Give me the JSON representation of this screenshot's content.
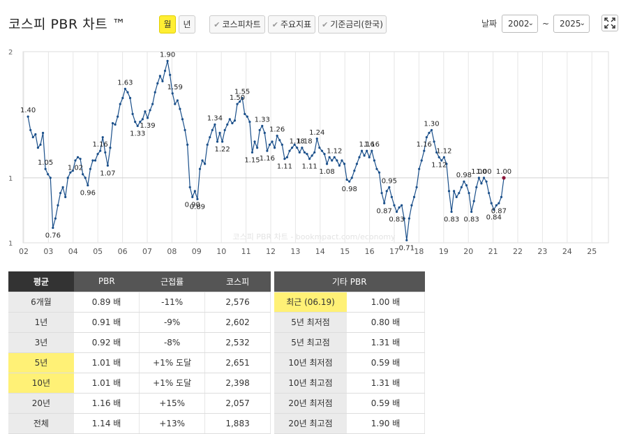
{
  "header": {
    "title": "코스피 PBR 차트 ™",
    "period_month": "월",
    "period_year": "년",
    "toggle_kospi": "코스피차트",
    "toggle_indicators": "주요지표",
    "toggle_rate": "기준금리(한국)",
    "date_label": "날짜",
    "start_year": "2002",
    "end_year": "2025",
    "tilde": "~"
  },
  "chart_data": {
    "type": "line",
    "y_scale": "log",
    "ylim": [
      1,
      2
    ],
    "y_ticks": [
      "1",
      "1",
      "2"
    ],
    "x_ticks": [
      "02",
      "03",
      "04",
      "05",
      "06",
      "07",
      "08",
      "09",
      "10",
      "11",
      "12",
      "13",
      "14",
      "15",
      "16",
      "17",
      "18",
      "19",
      "20",
      "21",
      "22",
      "23",
      "24",
      "25"
    ],
    "watermark": "코스피 PBR 차트 - bookmpact.com/economy",
    "colors": {
      "line": "#1a4f8a",
      "last_point": "#8b1538"
    },
    "x_start": 2002.0,
    "x_end": 2025.5,
    "series": [
      {
        "points": [
          [
            2002.2,
            1.4
          ],
          [
            2002.3,
            1.3
          ],
          [
            2002.4,
            1.25
          ],
          [
            2002.5,
            1.27
          ],
          [
            2002.6,
            1.18
          ],
          [
            2002.7,
            1.2
          ],
          [
            2002.8,
            1.28
          ],
          [
            2002.9,
            1.05
          ],
          [
            2003.0,
            1.02
          ],
          [
            2003.1,
            1.0
          ],
          [
            2003.2,
            0.76
          ],
          [
            2003.3,
            0.8
          ],
          [
            2003.4,
            0.86
          ],
          [
            2003.5,
            0.92
          ],
          [
            2003.6,
            0.95
          ],
          [
            2003.7,
            0.9
          ],
          [
            2003.8,
            1.0
          ],
          [
            2003.9,
            1.03
          ],
          [
            2004.0,
            1.04
          ],
          [
            2004.1,
            1.1
          ],
          [
            2004.2,
            1.12
          ],
          [
            2004.3,
            1.11
          ],
          [
            2004.4,
            1.02
          ],
          [
            2004.5,
            1.0
          ],
          [
            2004.6,
            0.96
          ],
          [
            2004.7,
            1.05
          ],
          [
            2004.8,
            1.1
          ],
          [
            2004.9,
            1.1
          ],
          [
            2005.0,
            1.14
          ],
          [
            2005.1,
            1.16
          ],
          [
            2005.2,
            1.25
          ],
          [
            2005.3,
            1.15
          ],
          [
            2005.4,
            1.07
          ],
          [
            2005.5,
            1.18
          ],
          [
            2005.6,
            1.35
          ],
          [
            2005.7,
            1.34
          ],
          [
            2005.8,
            1.4
          ],
          [
            2005.9,
            1.5
          ],
          [
            2006.0,
            1.55
          ],
          [
            2006.1,
            1.63
          ],
          [
            2006.2,
            1.6
          ],
          [
            2006.3,
            1.55
          ],
          [
            2006.4,
            1.42
          ],
          [
            2006.5,
            1.36
          ],
          [
            2006.6,
            1.33
          ],
          [
            2006.7,
            1.36
          ],
          [
            2006.8,
            1.38
          ],
          [
            2006.9,
            1.44
          ],
          [
            2007.0,
            1.39
          ],
          [
            2007.1,
            1.45
          ],
          [
            2007.2,
            1.5
          ],
          [
            2007.3,
            1.6
          ],
          [
            2007.4,
            1.68
          ],
          [
            2007.5,
            1.75
          ],
          [
            2007.6,
            1.7
          ],
          [
            2007.7,
            1.8
          ],
          [
            2007.8,
            1.9
          ],
          [
            2007.9,
            1.76
          ],
          [
            2008.0,
            1.59
          ],
          [
            2008.1,
            1.5
          ],
          [
            2008.2,
            1.53
          ],
          [
            2008.3,
            1.46
          ],
          [
            2008.4,
            1.38
          ],
          [
            2008.5,
            1.3
          ],
          [
            2008.6,
            1.2
          ],
          [
            2008.7,
            0.95
          ],
          [
            2008.8,
            0.9
          ],
          [
            2008.9,
            0.93
          ],
          [
            2009.0,
            0.89
          ],
          [
            2009.1,
            1.05
          ],
          [
            2009.2,
            1.1
          ],
          [
            2009.3,
            1.08
          ],
          [
            2009.4,
            1.2
          ],
          [
            2009.5,
            1.25
          ],
          [
            2009.6,
            1.3
          ],
          [
            2009.7,
            1.34
          ],
          [
            2009.8,
            1.22
          ],
          [
            2009.9,
            1.28
          ],
          [
            2010.0,
            1.22
          ],
          [
            2010.1,
            1.3
          ],
          [
            2010.2,
            1.34
          ],
          [
            2010.3,
            1.38
          ],
          [
            2010.4,
            1.35
          ],
          [
            2010.5,
            1.37
          ],
          [
            2010.6,
            1.5
          ],
          [
            2010.7,
            1.52
          ],
          [
            2010.8,
            1.55
          ],
          [
            2010.9,
            1.42
          ],
          [
            2011.0,
            1.4
          ],
          [
            2011.1,
            1.36
          ],
          [
            2011.2,
            1.15
          ],
          [
            2011.3,
            1.22
          ],
          [
            2011.4,
            1.18
          ],
          [
            2011.5,
            1.3
          ],
          [
            2011.6,
            1.33
          ],
          [
            2011.7,
            1.28
          ],
          [
            2011.8,
            1.16
          ],
          [
            2011.9,
            1.2
          ],
          [
            2012.0,
            1.22
          ],
          [
            2012.1,
            1.18
          ],
          [
            2012.2,
            1.26
          ],
          [
            2012.3,
            1.23
          ],
          [
            2012.4,
            1.2
          ],
          [
            2012.5,
            1.11
          ],
          [
            2012.6,
            1.12
          ],
          [
            2012.7,
            1.16
          ],
          [
            2012.8,
            1.18
          ],
          [
            2012.9,
            1.2
          ],
          [
            2013.0,
            1.18
          ],
          [
            2013.1,
            1.15
          ],
          [
            2013.2,
            1.18
          ],
          [
            2013.3,
            1.15
          ],
          [
            2013.4,
            1.14
          ],
          [
            2013.5,
            1.11
          ],
          [
            2013.6,
            1.13
          ],
          [
            2013.7,
            1.15
          ],
          [
            2013.8,
            1.24
          ],
          [
            2013.9,
            1.18
          ],
          [
            2014.0,
            1.16
          ],
          [
            2014.1,
            1.14
          ],
          [
            2014.2,
            1.08
          ],
          [
            2014.3,
            1.12
          ],
          [
            2014.4,
            1.1
          ],
          [
            2014.5,
            1.12
          ],
          [
            2014.6,
            1.1
          ],
          [
            2014.7,
            1.07
          ],
          [
            2014.8,
            1.1
          ],
          [
            2014.9,
            1.08
          ],
          [
            2015.0,
            0.99
          ],
          [
            2015.1,
            0.98
          ],
          [
            2015.2,
            1.0
          ],
          [
            2015.3,
            1.04
          ],
          [
            2015.4,
            1.08
          ],
          [
            2015.5,
            1.12
          ],
          [
            2015.6,
            1.16
          ],
          [
            2015.7,
            1.13
          ],
          [
            2015.8,
            1.16
          ],
          [
            2015.9,
            1.12
          ],
          [
            2016.0,
            1.16
          ],
          [
            2016.1,
            1.1
          ],
          [
            2016.2,
            1.05
          ],
          [
            2016.3,
            1.03
          ],
          [
            2016.4,
            0.92
          ],
          [
            2016.5,
            0.87
          ],
          [
            2016.6,
            0.93
          ],
          [
            2016.7,
            0.95
          ],
          [
            2016.8,
            0.9
          ],
          [
            2016.9,
            0.86
          ],
          [
            2017.0,
            0.83
          ],
          [
            2017.1,
            0.85
          ],
          [
            2017.2,
            0.86
          ],
          [
            2017.3,
            0.8
          ],
          [
            2017.4,
            0.71
          ],
          [
            2017.5,
            0.8
          ],
          [
            2017.6,
            0.86
          ],
          [
            2017.7,
            0.9
          ],
          [
            2017.8,
            0.95
          ],
          [
            2017.9,
            1.05
          ],
          [
            2018.0,
            1.1
          ],
          [
            2018.1,
            1.16
          ],
          [
            2018.2,
            1.25
          ],
          [
            2018.3,
            1.28
          ],
          [
            2018.4,
            1.3
          ],
          [
            2018.5,
            1.22
          ],
          [
            2018.6,
            1.15
          ],
          [
            2018.7,
            1.12
          ],
          [
            2018.8,
            1.1
          ],
          [
            2018.9,
            1.12
          ],
          [
            2019.0,
            1.08
          ],
          [
            2019.1,
            0.93
          ],
          [
            2019.2,
            0.83
          ],
          [
            2019.3,
            0.93
          ],
          [
            2019.4,
            0.9
          ],
          [
            2019.5,
            0.92
          ],
          [
            2019.6,
            0.95
          ],
          [
            2019.7,
            0.98
          ],
          [
            2019.8,
            0.96
          ],
          [
            2019.9,
            0.92
          ],
          [
            2020.0,
            0.83
          ],
          [
            2020.1,
            0.88
          ],
          [
            2020.2,
            0.95
          ],
          [
            2020.3,
            1.0
          ],
          [
            2020.4,
            0.97
          ],
          [
            2020.5,
            1.0
          ],
          [
            2020.6,
            0.98
          ],
          [
            2020.7,
            0.92
          ],
          [
            2020.8,
            0.87
          ],
          [
            2020.9,
            0.84
          ],
          [
            2021.0,
            0.86
          ],
          [
            2021.1,
            0.87
          ],
          [
            2021.2,
            0.9
          ],
          [
            2021.3,
            1.0
          ]
        ]
      }
    ],
    "annotations": [
      {
        "x": 2002.2,
        "y": 1.4,
        "text": "1.40",
        "pos": "above"
      },
      {
        "x": 2002.9,
        "y": 1.05,
        "text": "1.05",
        "pos": "above"
      },
      {
        "x": 2003.2,
        "y": 0.76,
        "text": "0.76",
        "pos": "below"
      },
      {
        "x": 2004.1,
        "y": 1.02,
        "text": "1.02",
        "pos": "above"
      },
      {
        "x": 2004.6,
        "y": 0.96,
        "text": "0.96",
        "pos": "below"
      },
      {
        "x": 2005.1,
        "y": 1.16,
        "text": "1.16",
        "pos": "above"
      },
      {
        "x": 2005.4,
        "y": 1.07,
        "text": "1.07",
        "pos": "below"
      },
      {
        "x": 2006.1,
        "y": 1.63,
        "text": "1.63",
        "pos": "above"
      },
      {
        "x": 2006.6,
        "y": 1.33,
        "text": "1.33",
        "pos": "below"
      },
      {
        "x": 2007.0,
        "y": 1.39,
        "text": "1.39",
        "pos": "below"
      },
      {
        "x": 2007.8,
        "y": 1.9,
        "text": "1.90",
        "pos": "above"
      },
      {
        "x": 2008.1,
        "y": 1.59,
        "text": "1.59",
        "pos": "above"
      },
      {
        "x": 2008.8,
        "y": 0.9,
        "text": "0.90",
        "pos": "below"
      },
      {
        "x": 2009.0,
        "y": 0.89,
        "text": "0.89",
        "pos": "below"
      },
      {
        "x": 2009.7,
        "y": 1.34,
        "text": "1.34",
        "pos": "above"
      },
      {
        "x": 2010.0,
        "y": 1.22,
        "text": "1.22",
        "pos": "below"
      },
      {
        "x": 2010.6,
        "y": 1.5,
        "text": "1.50",
        "pos": "above"
      },
      {
        "x": 2010.8,
        "y": 1.55,
        "text": "1.55",
        "pos": "above"
      },
      {
        "x": 2011.2,
        "y": 1.15,
        "text": "1.15",
        "pos": "below"
      },
      {
        "x": 2011.6,
        "y": 1.33,
        "text": "1.33",
        "pos": "above"
      },
      {
        "x": 2011.8,
        "y": 1.16,
        "text": "1.16",
        "pos": "below"
      },
      {
        "x": 2012.2,
        "y": 1.26,
        "text": "1.26",
        "pos": "above"
      },
      {
        "x": 2012.5,
        "y": 1.11,
        "text": "1.11",
        "pos": "below"
      },
      {
        "x": 2013.0,
        "y": 1.18,
        "text": "1.18",
        "pos": "above"
      },
      {
        "x": 2013.3,
        "y": 1.18,
        "text": "1.18",
        "pos": "above"
      },
      {
        "x": 2013.5,
        "y": 1.11,
        "text": "1.11",
        "pos": "below"
      },
      {
        "x": 2013.8,
        "y": 1.24,
        "text": "1.24",
        "pos": "above"
      },
      {
        "x": 2014.2,
        "y": 1.08,
        "text": "1.08",
        "pos": "below"
      },
      {
        "x": 2014.5,
        "y": 1.12,
        "text": "1.12",
        "pos": "above"
      },
      {
        "x": 2015.1,
        "y": 0.98,
        "text": "0.98",
        "pos": "below"
      },
      {
        "x": 2015.8,
        "y": 1.16,
        "text": "1.16",
        "pos": "above"
      },
      {
        "x": 2016.0,
        "y": 1.16,
        "text": "1.16",
        "pos": "above"
      },
      {
        "x": 2016.5,
        "y": 0.87,
        "text": "0.87",
        "pos": "below"
      },
      {
        "x": 2016.7,
        "y": 0.95,
        "text": "0.95",
        "pos": "above"
      },
      {
        "x": 2017.0,
        "y": 0.83,
        "text": "0.83",
        "pos": "below"
      },
      {
        "x": 2017.4,
        "y": 0.71,
        "text": "0.71",
        "pos": "below"
      },
      {
        "x": 2018.1,
        "y": 1.16,
        "text": "1.16",
        "pos": "above"
      },
      {
        "x": 2018.4,
        "y": 1.3,
        "text": "1.30",
        "pos": "above"
      },
      {
        "x": 2018.7,
        "y": 1.12,
        "text": "1.12",
        "pos": "below"
      },
      {
        "x": 2018.9,
        "y": 1.12,
        "text": "1.12",
        "pos": "above"
      },
      {
        "x": 2019.2,
        "y": 0.83,
        "text": "0.83",
        "pos": "below"
      },
      {
        "x": 2019.7,
        "y": 0.98,
        "text": "0.98",
        "pos": "above"
      },
      {
        "x": 2020.0,
        "y": 0.83,
        "text": "0.83",
        "pos": "below"
      },
      {
        "x": 2020.3,
        "y": 1.0,
        "text": "1.00",
        "pos": "above"
      },
      {
        "x": 2020.5,
        "y": 1.0,
        "text": "1.00",
        "pos": "above"
      },
      {
        "x": 2020.9,
        "y": 0.84,
        "text": "0.84",
        "pos": "below"
      },
      {
        "x": 2021.1,
        "y": 0.87,
        "text": "0.87",
        "pos": "below"
      },
      {
        "x": 2021.3,
        "y": 1.0,
        "text": "1.00",
        "pos": "above"
      }
    ]
  },
  "avg_table": {
    "headers": [
      "평균",
      "PBR",
      "근접률",
      "코스피"
    ],
    "rows": [
      {
        "label": "6개월",
        "pbr": "0.89 배",
        "rate": "-11%",
        "kospi": "2,576",
        "hl": false,
        "sign": "neg"
      },
      {
        "label": "1년",
        "pbr": "0.91 배",
        "rate": "-9%",
        "kospi": "2,602",
        "hl": false,
        "sign": "neg"
      },
      {
        "label": "3년",
        "pbr": "0.92 배",
        "rate": "-8%",
        "kospi": "2,532",
        "hl": false,
        "sign": "neg"
      },
      {
        "label": "5년",
        "pbr": "1.01 배",
        "rate": "+1% 도달",
        "kospi": "2,651",
        "hl": true,
        "sign": "pos"
      },
      {
        "label": "10년",
        "pbr": "1.01 배",
        "rate": "+1% 도달",
        "kospi": "2,398",
        "hl": true,
        "sign": "pos"
      },
      {
        "label": "20년",
        "pbr": "1.16 배",
        "rate": "+15%",
        "kospi": "2,057",
        "hl": false,
        "sign": "pos"
      },
      {
        "label": "전체",
        "pbr": "1.14 배",
        "rate": "+13%",
        "kospi": "1,883",
        "hl": false,
        "sign": "pos"
      }
    ]
  },
  "other_table": {
    "header": "기타 PBR",
    "rows": [
      {
        "label": "최근 (06.19)",
        "value": "1.00 배",
        "hl": true
      },
      {
        "label": "5년 최저점",
        "value": "0.80 배",
        "hl": false
      },
      {
        "label": "5년 최고점",
        "value": "1.31 배",
        "hl": false
      },
      {
        "label": "10년 최저점",
        "value": "0.59 배",
        "hl": false
      },
      {
        "label": "10년 최고점",
        "value": "1.31 배",
        "hl": false
      },
      {
        "label": "20년 최저점",
        "value": "0.59 배",
        "hl": false
      },
      {
        "label": "20년 최고점",
        "value": "1.90 배",
        "hl": false
      }
    ]
  }
}
